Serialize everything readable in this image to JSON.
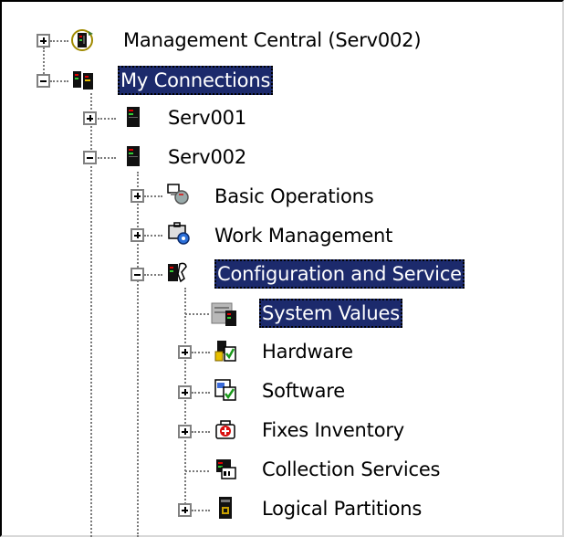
{
  "tree": {
    "management_central": "Management Central (Serv002)",
    "my_connections": "My Connections",
    "serv001": "Serv001",
    "serv002": "Serv002",
    "basic_operations": "Basic Operations",
    "work_management": "Work Management",
    "configuration_and_service": "Configuration and Service",
    "system_values": "System Values",
    "hardware": "Hardware",
    "software": "Software",
    "fixes_inventory": "Fixes Inventory",
    "collection_services": "Collection Services",
    "logical_partitions": "Logical Partitions"
  },
  "colors": {
    "selection": "#1c2a6c",
    "selection_text": "#ffffff"
  }
}
